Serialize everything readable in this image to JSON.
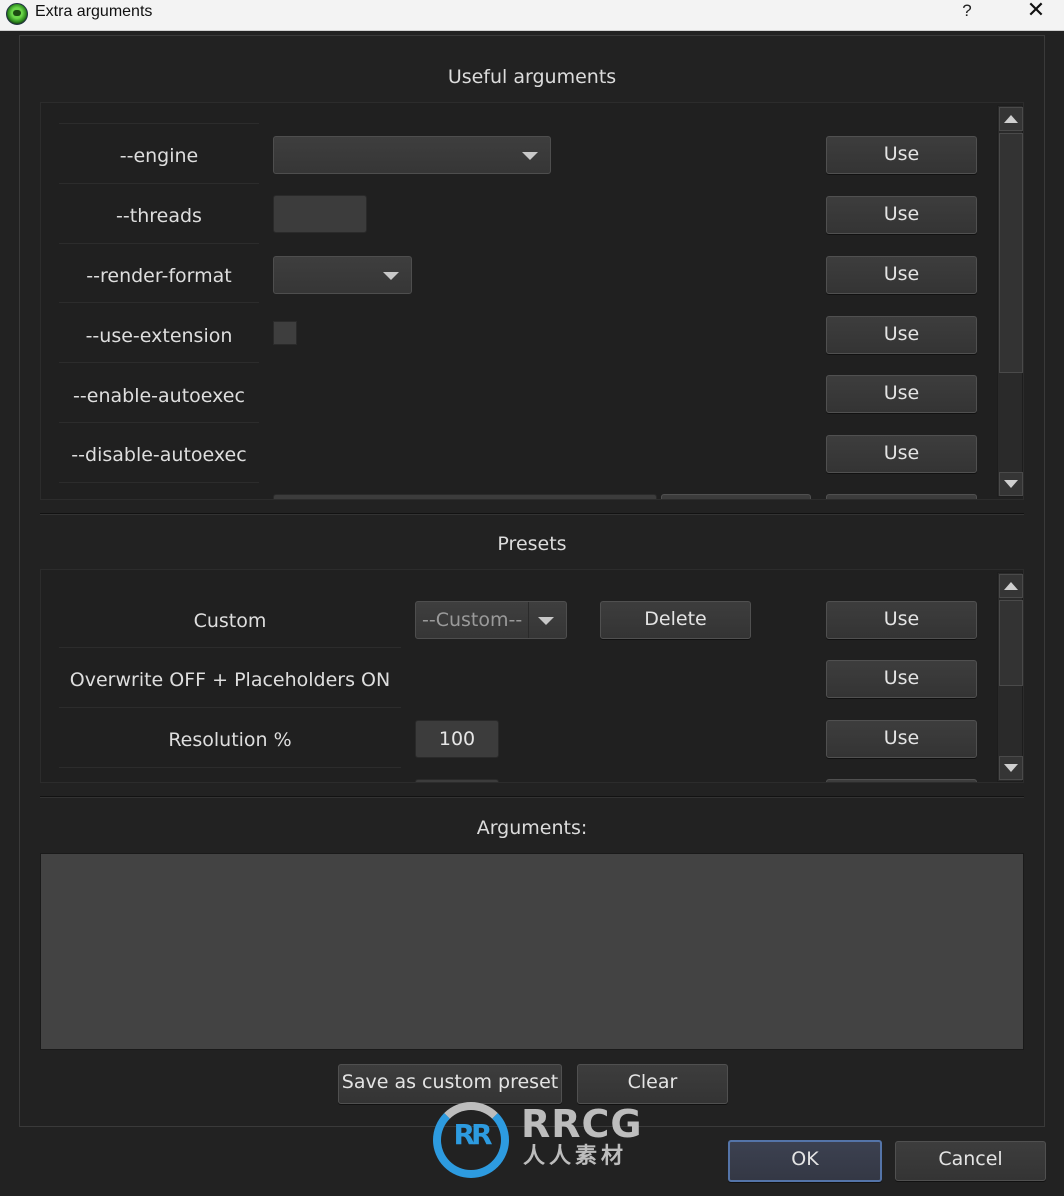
{
  "window": {
    "title": "Extra arguments",
    "help_label": "?",
    "close_label": "✕"
  },
  "useful": {
    "title": "Useful arguments",
    "rows": [
      {
        "label": "--engine",
        "control": "combo",
        "value": "",
        "use_label": "Use"
      },
      {
        "label": "--threads",
        "control": "field",
        "value": "",
        "use_label": "Use"
      },
      {
        "label": "--render-format",
        "control": "combo",
        "value": "",
        "use_label": "Use"
      },
      {
        "label": "--use-extension",
        "control": "checkbox",
        "checked": false,
        "use_label": "Use"
      },
      {
        "label": "--enable-autoexec",
        "control": "none",
        "use_label": "Use"
      },
      {
        "label": "--disable-autoexec",
        "control": "none",
        "use_label": "Use"
      },
      {
        "label": "",
        "control": "field-with-button",
        "value": "",
        "button_label": "",
        "use_label": ""
      }
    ]
  },
  "presets": {
    "title": "Presets",
    "rows": [
      {
        "label": "Custom",
        "combo_value": "--Custom--",
        "delete_label": "Delete",
        "use_label": "Use"
      },
      {
        "label": "Overwrite OFF + Placeholders ON",
        "use_label": "Use"
      },
      {
        "label": "Resolution %",
        "value": "100",
        "use_label": "Use"
      },
      {
        "label": "",
        "value": "",
        "use_label": ""
      }
    ]
  },
  "arguments": {
    "title": "Arguments:",
    "value": "",
    "save_preset_label": "Save as custom preset",
    "clear_label": "Clear"
  },
  "dialog": {
    "ok_label": "OK",
    "cancel_label": "Cancel"
  },
  "watermark": {
    "logo_text": "RR",
    "title": "RRCG",
    "subtitle": "人人素材"
  },
  "colors": {
    "background": "#222222",
    "ok_border": "#5474a8",
    "watermark_blue": "#2d9be0"
  }
}
